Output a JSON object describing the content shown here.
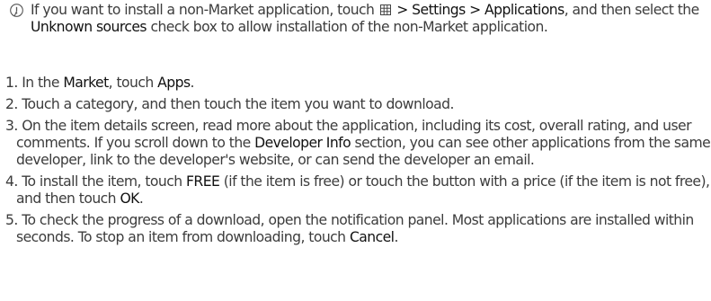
{
  "note": {
    "icon": "info-note-icon",
    "pre": "If you want to install a non-Market application, touch",
    "menu_icon": "menu-grid-icon",
    "path": "> Settings > Applications",
    "mid": ", and then select the",
    "unknown_sources": "Unknown sources",
    "post": "check box to allow installation of the non-Market application."
  },
  "steps": [
    {
      "num": "1.",
      "a": "In the",
      "market": "Market",
      "b": ", touch",
      "apps": "Apps",
      "c": "."
    },
    {
      "num": "2.",
      "a": "Touch a category, and then touch the item you want to download."
    },
    {
      "num": "3.",
      "a": "On the item details screen, read more about the application, including its cost, overall rating, and user comments. If you scroll down to the",
      "developer_info": "Developer Info",
      "b": "section, you can see other applications from the same developer, link to the developer's website, or can send the developer an email."
    },
    {
      "num": "4.",
      "a": "To install the item, touch",
      "free": "FREE",
      "b": "(if the item is free) or touch the button with a price (if the item is not free), and then touch",
      "ok": "OK",
      "c": "."
    },
    {
      "num": "5.",
      "a": "To check the progress of a download, open the notification panel. Most applications are installed within seconds. To stop an item from downloading, touch",
      "cancel": "Cancel",
      "b": "."
    }
  ]
}
